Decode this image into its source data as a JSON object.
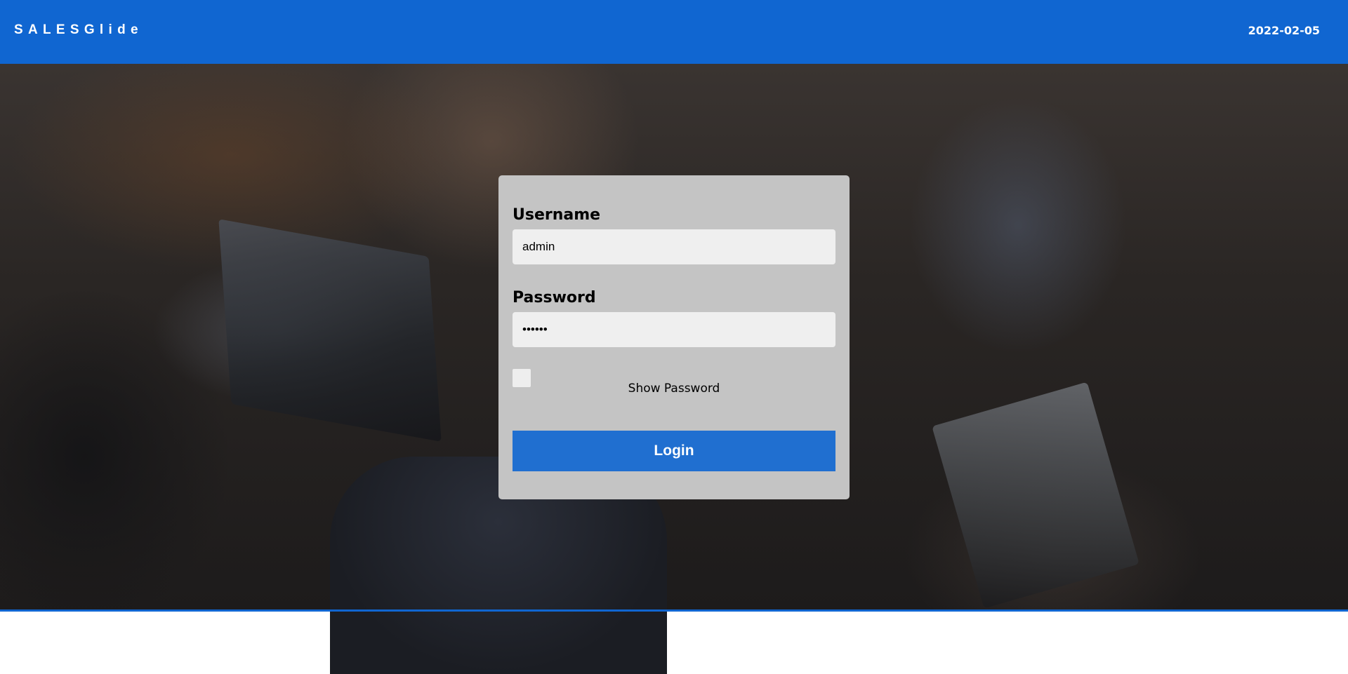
{
  "header": {
    "brand": "SALESGlide",
    "date": "2022-02-05"
  },
  "background": {
    "description_icon": "office-photo-background"
  },
  "login_form": {
    "username_label": "Username",
    "username_value": "admin",
    "password_label": "Password",
    "password_value": "••••••",
    "show_password_label": "Show Password",
    "show_password_checked": false,
    "login_button_label": "Login"
  },
  "colors": {
    "header_bg": "#1066d1",
    "button_bg": "#206fd0",
    "card_bg": "#c4c4c4"
  }
}
